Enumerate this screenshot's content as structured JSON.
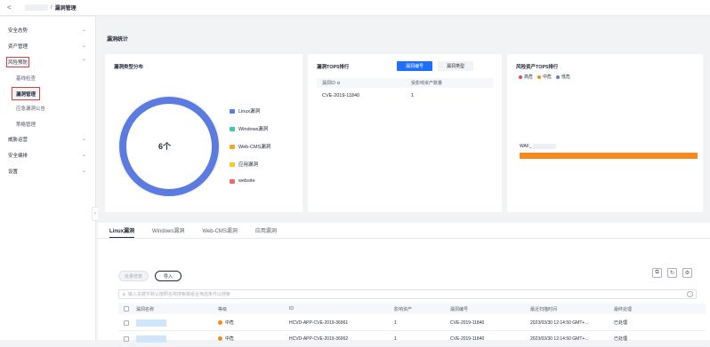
{
  "breadcrumb": {
    "back": "<",
    "sep": "/",
    "current": "漏洞管理"
  },
  "sidebar": {
    "items": [
      {
        "label": "安全态势",
        "chevron": "⌄"
      },
      {
        "label": "资产管理",
        "chevron": "⌄"
      },
      {
        "label": "风险预防",
        "chevron": "⌃"
      },
      {
        "label": "威胁运营",
        "chevron": "⌄"
      },
      {
        "label": "安全编排",
        "chevron": "⌄"
      },
      {
        "label": "设置",
        "chevron": "⌄"
      }
    ],
    "subitems": [
      "基线检查",
      "漏洞管理",
      "应急漏洞公告",
      "策略管理"
    ],
    "collapse": "‹"
  },
  "stats": {
    "title": "漏洞统计",
    "distribution": {
      "title": "漏洞类型分布",
      "center": "6个",
      "legend": [
        {
          "label": "Linux漏洞",
          "color": "#5b7be0"
        },
        {
          "label": "Windows漏洞",
          "color": "#40c8a8"
        },
        {
          "label": "Web-CMS漏洞",
          "color": "#f5a623"
        },
        {
          "label": "应用漏洞",
          "color": "#f8c81d"
        },
        {
          "label": "website",
          "color": "#f06a6a"
        }
      ]
    },
    "top5": {
      "title": "漏洞TOP5排行",
      "tab_active": "漏洞编号",
      "tab_inactive": "漏洞类型",
      "col_id": "漏洞ID ⊖",
      "col_count": "受影响资产数量",
      "rows": [
        {
          "id": "CVE-2019-11840",
          "count": "1"
        }
      ]
    },
    "risk": {
      "title": "风险资产TOP5排行",
      "legend": [
        {
          "label": "高危",
          "color": "#e84c4c"
        },
        {
          "label": "中危",
          "color": "#f58b1f"
        },
        {
          "label": "低危",
          "color": "#5b7be0"
        }
      ],
      "bar_label": "WAF_",
      "bar_color": "#f58b1f"
    }
  },
  "tabs": [
    "Linux漏洞",
    "Windows漏洞",
    "Web-CMS漏洞",
    "应用漏洞"
  ],
  "toolbar": {
    "batch": "批量修复",
    "import": "导入"
  },
  "icons": {
    "export": "⧉",
    "refresh": "↻",
    "settings": "⚙"
  },
  "search": {
    "placeholder": "输入关键字默认按照名称搜索或组合筛选条件以搜索",
    "icon": "⌕",
    "help": "?"
  },
  "table": {
    "headers": [
      "漏洞名称",
      "等级",
      "ID",
      "影响资产",
      "漏洞编号",
      "最近扫描时间",
      "最终处理"
    ],
    "rows": [
      {
        "level": "中危",
        "id": "HCVD-APP-CVE-2019-36961",
        "assets": "1",
        "cve": "CVE-2019-11840",
        "time": "2023/03/30 12:14:50 GMT+...",
        "status": "已处理"
      },
      {
        "level": "中危",
        "id": "HCVD-APP-CVE-2019-36962",
        "assets": "1",
        "cve": "CVE-2019-11840",
        "time": "2023/03/30 12:14:50 GMT+...",
        "status": "已处理"
      }
    ]
  }
}
